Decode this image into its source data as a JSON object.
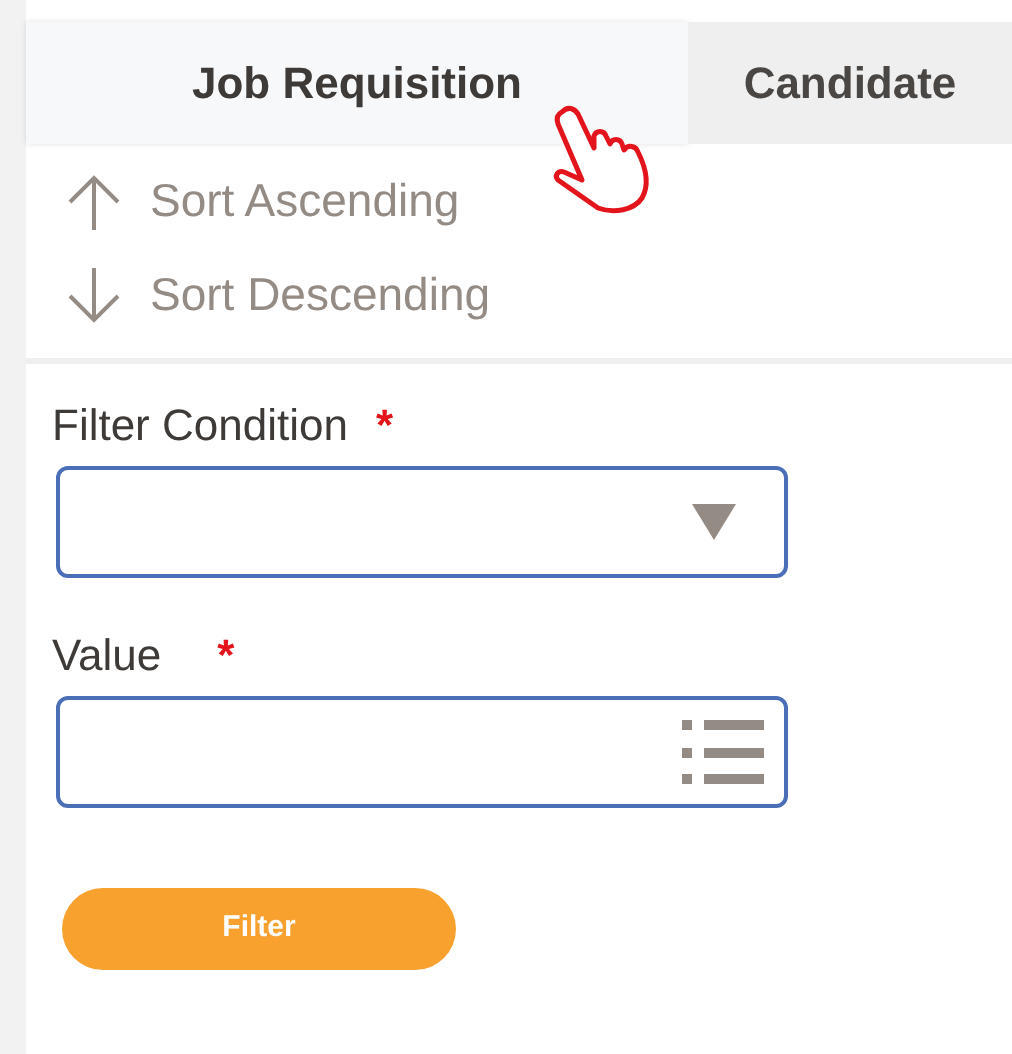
{
  "tabs": [
    {
      "label": "Job Requisition",
      "selected": true
    },
    {
      "label": "Candidate",
      "selected": false
    }
  ],
  "sort_options": [
    {
      "label": "Sort Ascending",
      "kind": "ascending"
    },
    {
      "label": "Sort Descending",
      "kind": "descending"
    }
  ],
  "fields": [
    {
      "label": "Filter Condition",
      "required": true,
      "kind": "dropdown"
    },
    {
      "label": "Value",
      "required": true,
      "kind": "list"
    }
  ],
  "required_mark": "*",
  "button": "Filter"
}
